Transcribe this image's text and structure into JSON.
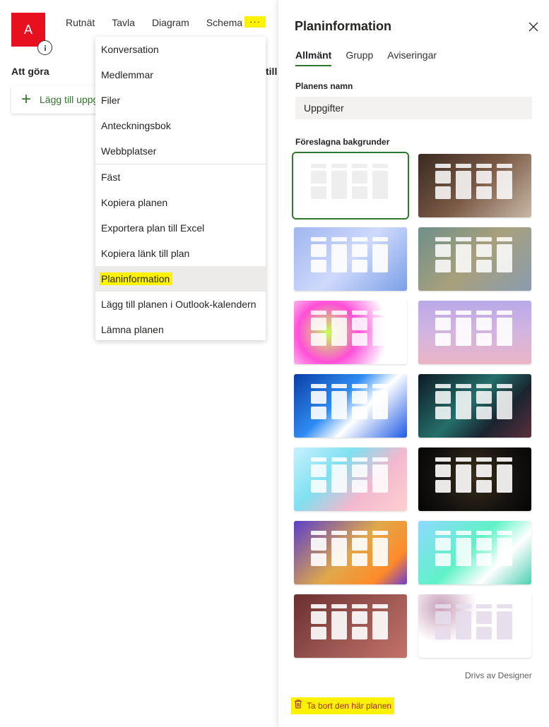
{
  "app": {
    "avatar_letter": "A",
    "tabs": [
      {
        "label": "Rutnät"
      },
      {
        "label": "Tavla",
        "active": true
      },
      {
        "label": "Diagram"
      },
      {
        "label": "Schema"
      }
    ],
    "more_label": "···",
    "bucket_title": "Att göra",
    "bucket_title_2": "till",
    "add_task_label": "Lägg till uppgift",
    "add_icon": "plus-icon",
    "info_icon": "info-icon"
  },
  "menu": {
    "items": [
      {
        "label": "Konversation"
      },
      {
        "label": "Medlemmar"
      },
      {
        "label": "Filer"
      },
      {
        "label": "Anteckningsbok"
      },
      {
        "label": "Webbplatser"
      },
      {
        "label": "Fäst"
      },
      {
        "label": "Kopiera planen"
      },
      {
        "label": "Exportera plan till Excel"
      },
      {
        "label": "Kopiera länk till plan"
      },
      {
        "label": "Planinformation",
        "selected": true
      },
      {
        "label": "Lägg till planen i Outlook-kalendern"
      },
      {
        "label": "Lämna planen"
      }
    ]
  },
  "panel": {
    "title": "Planinformation",
    "close_icon": "close-icon",
    "tabs": [
      {
        "label": "Allmänt",
        "active": true
      },
      {
        "label": "Grupp"
      },
      {
        "label": "Aviseringar"
      }
    ],
    "name_label": "Planens namn",
    "name_value": "Uppgifter",
    "backgrounds_label": "Föreslagna bakgrunder",
    "backgrounds": [
      {
        "name": "blank",
        "selected": true,
        "bg": "#ffffff",
        "tile": "#eeeeee"
      },
      {
        "name": "keyboard-desk",
        "bg": "linear-gradient(135deg,#3a2a22,#7a5a45 50%,#c8b9a7)",
        "tile": "rgba(255,255,255,0.85)"
      },
      {
        "name": "blue-charts",
        "bg": "linear-gradient(135deg,#9fb6f0,#cfd9fb 50%,#7aa0e8)",
        "tile": "rgba(255,255,255,0.9)"
      },
      {
        "name": "teal-camo",
        "bg": "linear-gradient(135deg,#6e8f8a,#a8a07c 50%,#8a9cb0)",
        "tile": "rgba(255,255,255,0.85)"
      },
      {
        "name": "paint-splash",
        "bg": "radial-gradient(circle at 30% 50%,#c6ff5a 0,#ff4fd8 35%,#ffffff 70%)",
        "tile": "rgba(255,255,255,0.85)"
      },
      {
        "name": "lavender-pink",
        "bg": "linear-gradient(180deg,#b9a9e8,#d3b4e0 50%,#eab5c5)",
        "tile": "rgba(255,255,255,0.9)"
      },
      {
        "name": "blue-wave",
        "bg": "linear-gradient(135deg,#0a3ea8,#2f8cf2 40%,#ffffff 60%,#1e5ae6)",
        "tile": "rgba(255,255,255,0.9)"
      },
      {
        "name": "dark-teal-swirl",
        "bg": "linear-gradient(135deg,#0d1a24,#256f6a 45%,#1a2430 70%,#5a2f3a)",
        "tile": "rgba(255,255,255,0.85)"
      },
      {
        "name": "pastel-swirl",
        "bg": "linear-gradient(135deg,#c8f1ff,#7fe0f0 35%,#f4b8cf 65%,#fdd0d0)",
        "tile": "rgba(255,255,255,0.85)"
      },
      {
        "name": "dark-shimmer",
        "bg": "radial-gradient(circle at 50% 45%,#3a2f1a 0,#141210 60%,#050505)",
        "tile": "rgba(255,255,255,0.9)"
      },
      {
        "name": "purple-orange",
        "bg": "linear-gradient(135deg,#5b3fc8,#e0a84a 50%,#ff8a2a 80%,#6c3cd0)",
        "tile": "rgba(255,255,255,0.9)"
      },
      {
        "name": "mint-swirl",
        "bg": "linear-gradient(135deg,#8fd9ff,#5ff2c6 45%,#ffffff 70%,#4cd0b0)",
        "tile": "rgba(255,255,255,0.85)"
      },
      {
        "name": "rust-mauve",
        "bg": "linear-gradient(135deg,#6a2f2f,#9a5550 50%,#c2726a)",
        "tile": "rgba(255,255,255,0.9)"
      },
      {
        "name": "confetti-dots",
        "bg": "radial-gradient(circle at 20% 20%,#c8a0b8 0,#ffffff 35%),#ffffff",
        "tile": "rgba(230,220,235,0.9)"
      }
    ],
    "designer_credit": "Drivs av Designer",
    "delete_label": "Ta bort den här planen",
    "delete_icon": "trash-icon"
  }
}
